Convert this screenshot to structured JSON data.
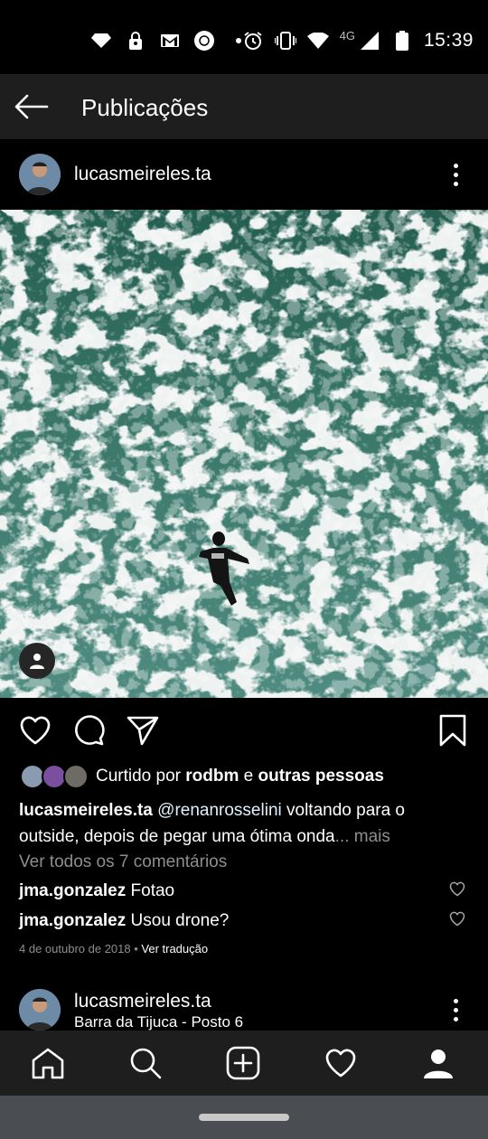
{
  "status_bar": {
    "network": "4G",
    "time": "15:39",
    "left_icons": [
      "diamond-icon",
      "lock-person-icon",
      "gmail-icon",
      "globo-app-icon",
      "dot-icon"
    ],
    "right_icons": [
      "alarm-icon",
      "vibrate-icon",
      "wifi-icon",
      "signal-icon",
      "battery-icon"
    ]
  },
  "app_bar": {
    "title": "Publicações"
  },
  "post": {
    "username": "lucasmeireles.ta",
    "likes": {
      "prefix": "Curtido por ",
      "user": "rodbm",
      "joiner": " e ",
      "others": "outras pessoas"
    },
    "caption": {
      "user": "lucasmeireles.ta",
      "mention": "@renanrosselini",
      "text": " voltando para o outside, depois de pegar uma ótima onda",
      "more": "... mais"
    },
    "view_comments": "Ver todos os 7 comentários",
    "comments": [
      {
        "user": "jma.gonzalez",
        "text": "Fotao"
      },
      {
        "user": "jma.gonzalez",
        "text": "Usou drone?"
      }
    ],
    "date": "4 de outubro de 2018",
    "separator": " • ",
    "translate": "Ver tradução"
  },
  "next_post": {
    "username": "lucasmeireles.ta",
    "location": "Barra da Tijuca - Posto 6"
  },
  "colors": {
    "background": "#000000",
    "bar": "#1e1e1e",
    "muted": "#8e8e8e",
    "sea_green": "#2f6e5e"
  }
}
